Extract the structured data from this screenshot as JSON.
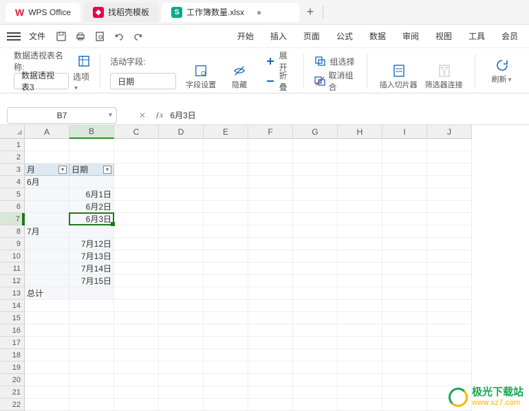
{
  "tabs": {
    "home": "WPS Office",
    "template": "找稻壳模板",
    "file": "工作簿数量.xlsx"
  },
  "menubar": {
    "file": "文件",
    "items": [
      "开始",
      "插入",
      "页面",
      "公式",
      "数据",
      "审阅",
      "视图",
      "工具",
      "会员"
    ]
  },
  "ribbon": {
    "pivot_name_label": "数据透视表名称:",
    "pivot_name_value": "数据透视表3",
    "options": "选项",
    "active_field_label": "活动字段:",
    "active_field_value": "日期",
    "field_settings": "字段设置",
    "hide": "隐藏",
    "expand": "展开",
    "collapse": "折叠",
    "group_select": "组选择",
    "ungroup": "取消组合",
    "insert_slicer": "插入切片器",
    "filter_connect": "筛选器连接",
    "refresh": "刷新"
  },
  "fx": {
    "namebox": "B7",
    "value": "6月3日"
  },
  "grid": {
    "cols": [
      "A",
      "B",
      "C",
      "D",
      "E",
      "F",
      "G",
      "H",
      "I",
      "J"
    ],
    "row_count": 22,
    "selected": {
      "row": 7,
      "col": "B"
    },
    "headers": {
      "A": "月",
      "B": "日期"
    },
    "data": {
      "r4": {
        "A": "6月"
      },
      "r5": {
        "B": "6月1日"
      },
      "r6": {
        "B": "6月2日"
      },
      "r7": {
        "B": "6月3日"
      },
      "r8": {
        "A": "7月"
      },
      "r9": {
        "B": "7月12日"
      },
      "r10": {
        "B": "7月13日"
      },
      "r11": {
        "B": "7月14日"
      },
      "r12": {
        "B": "7月15日"
      },
      "r13": {
        "A": "总计"
      }
    }
  },
  "watermark": {
    "cn": "极光下载站",
    "en": "www.xz7.com"
  }
}
